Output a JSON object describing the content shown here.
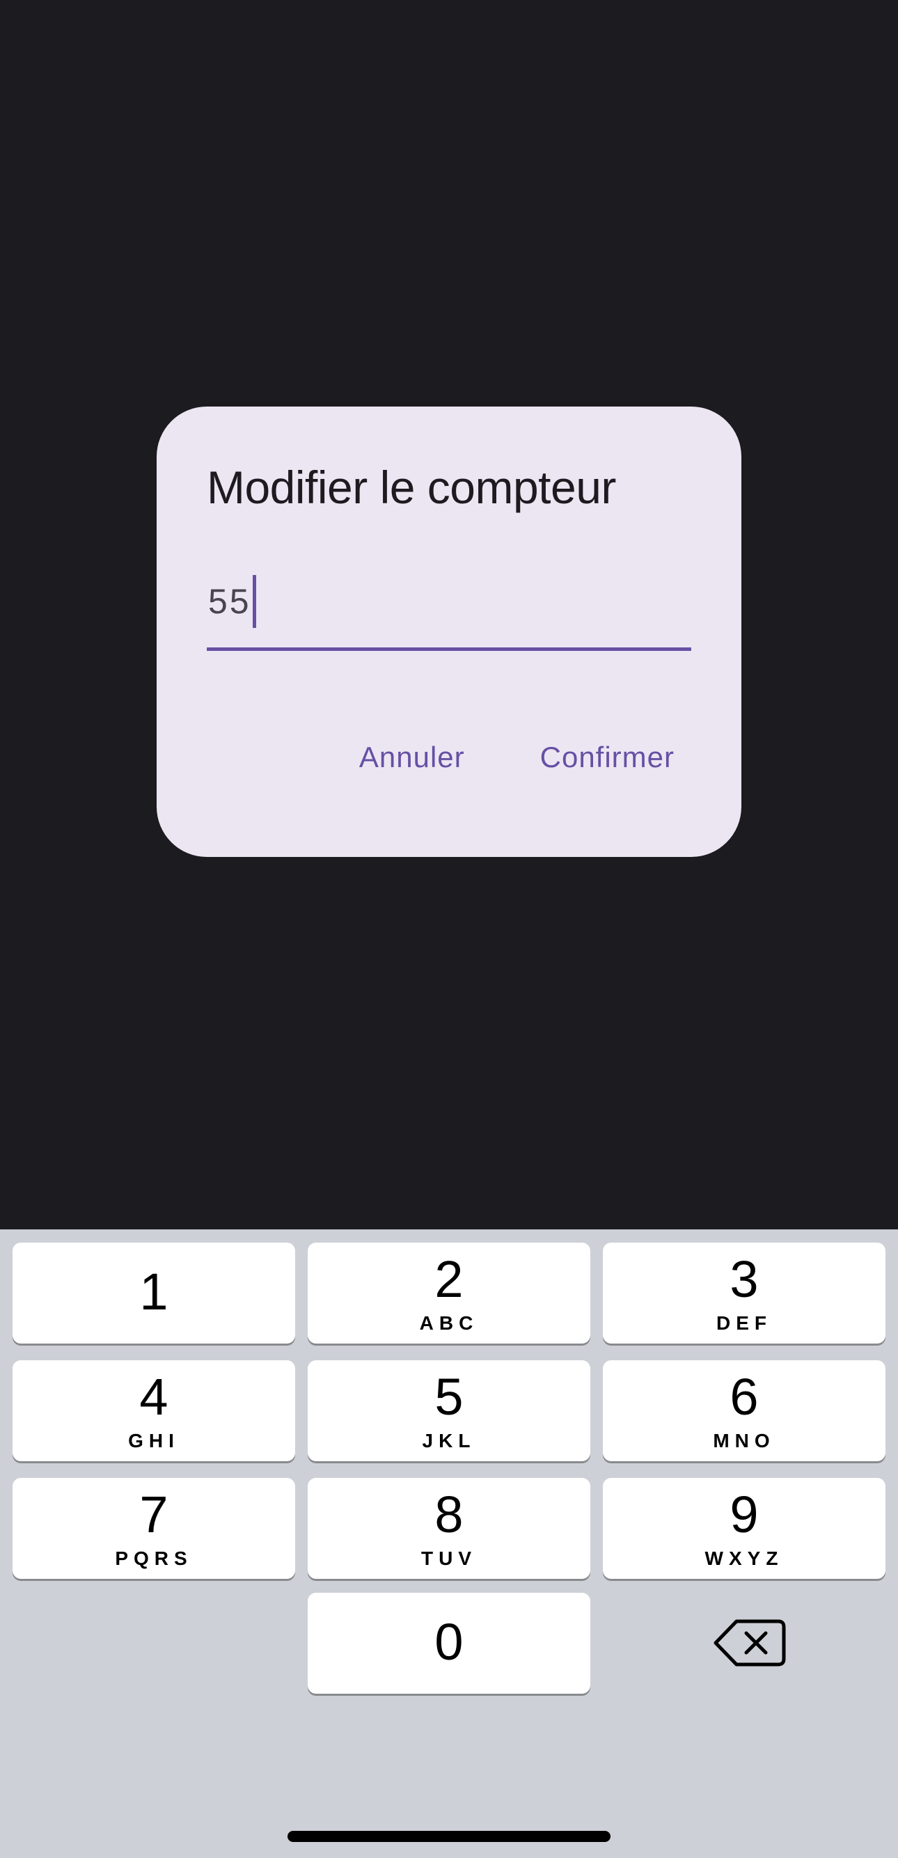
{
  "dialog": {
    "title": "Modifier le compteur",
    "counter_value": "55",
    "cancel_label": "Annuler",
    "confirm_label": "Confirmer"
  },
  "keypad": {
    "keys": [
      {
        "digit": "1",
        "letters": ""
      },
      {
        "digit": "2",
        "letters": "ABC"
      },
      {
        "digit": "3",
        "letters": "DEF"
      },
      {
        "digit": "4",
        "letters": "GHI"
      },
      {
        "digit": "5",
        "letters": "JKL"
      },
      {
        "digit": "6",
        "letters": "MNO"
      },
      {
        "digit": "7",
        "letters": "PQRS"
      },
      {
        "digit": "8",
        "letters": "TUV"
      },
      {
        "digit": "9",
        "letters": "WXYZ"
      },
      {
        "digit": "0",
        "letters": ""
      }
    ],
    "backspace_icon": "backspace-icon"
  },
  "colors": {
    "background": "#1c1b1f",
    "dialog_surface": "#ece6f3",
    "accent": "#6750a4",
    "keyboard_bg": "#cdd0d6",
    "key_bg": "#ffffff"
  }
}
